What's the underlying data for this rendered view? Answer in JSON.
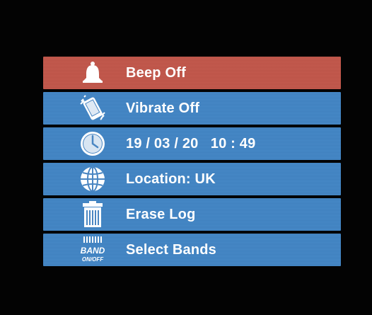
{
  "menu": {
    "items": [
      {
        "label": "Beep Off",
        "icon": "bell-icon",
        "selected": true
      },
      {
        "label": "Vibrate Off",
        "icon": "vibrate-phone-icon",
        "selected": false
      },
      {
        "label": "19 / 03 / 20   10 : 49",
        "icon": "clock-icon",
        "selected": false
      },
      {
        "label": "Location: UK",
        "icon": "globe-icon",
        "selected": false
      },
      {
        "label": "Erase Log",
        "icon": "trash-bin-icon",
        "selected": false
      },
      {
        "label": "Select Bands",
        "icon": "band-toggle-icon",
        "selected": false
      }
    ],
    "band_icon_text": {
      "top": "BAND",
      "bottom": "ON/OFF"
    }
  },
  "colors": {
    "selected_row": "#c25448",
    "row": "#3f84c5",
    "background": "#030303",
    "text": "#ffffff"
  }
}
